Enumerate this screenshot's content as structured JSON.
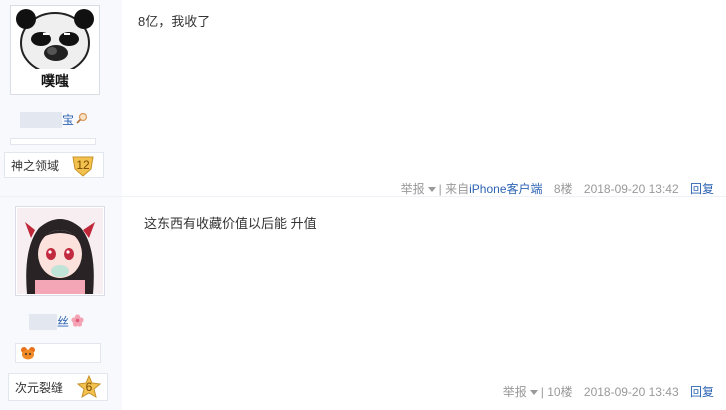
{
  "posts": [
    {
      "user": {
        "avatar_caption": "噗嗤",
        "name_partial": "宝",
        "forum_badge_name": "神之领域",
        "level": "12"
      },
      "content": "8亿，我收了",
      "meta": {
        "report_label": "举报",
        "separator": "|",
        "source_prefix": "来自",
        "source_link": "iPhone客户端",
        "floor": "8楼",
        "timestamp": "2018-09-20 13:42",
        "reply_label": "回复"
      }
    },
    {
      "user": {
        "name_partial": "丝",
        "forum_badge_name": "次元裂缝",
        "level": "6"
      },
      "content": "这东西有收藏价值以后能 升值",
      "meta": {
        "report_label": "举报",
        "separator": "|",
        "floor": "10楼",
        "timestamp": "2018-09-20 13:43",
        "reply_label": "回复"
      }
    }
  ],
  "colors": {
    "link": "#2d64b3",
    "meta": "#999999",
    "sidebar_bg": "#f7f9fc",
    "level_badge_gold": "#f2c14e"
  },
  "icons": [
    "magnifier-icon",
    "level-shield-icon",
    "flower-icon",
    "orange-bear-icon",
    "level-star-icon",
    "dropdown-triangle-icon"
  ]
}
